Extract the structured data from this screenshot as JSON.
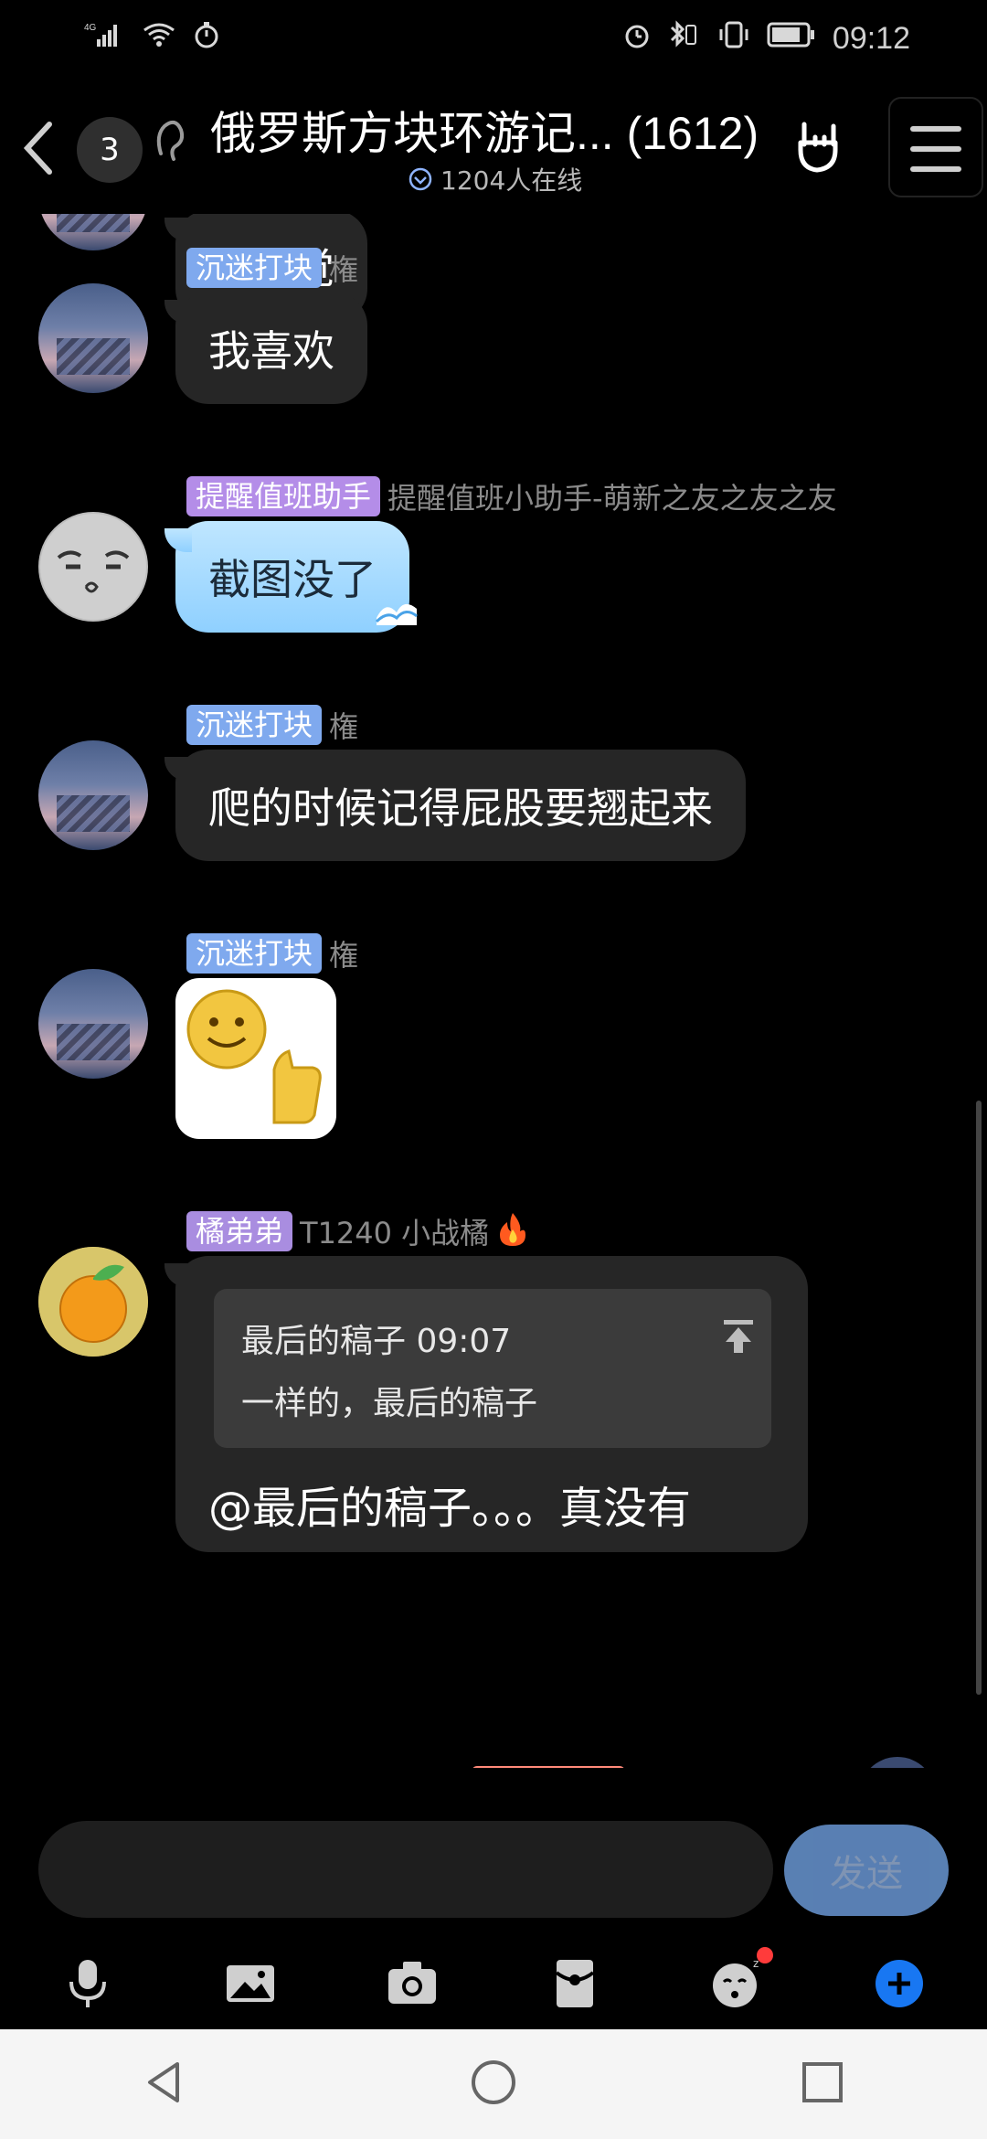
{
  "status_bar": {
    "network": "4G",
    "time": "09:12"
  },
  "header": {
    "unread_count": "3",
    "group_title": "俄罗斯方块环游记... (1612)",
    "online_text": "1204人在线"
  },
  "messages": [
    {
      "type": "text",
      "text": "很自觉"
    },
    {
      "type": "text",
      "tag": "沉迷打块",
      "sender": "権",
      "text": "我喜欢"
    },
    {
      "type": "text_special",
      "tag": "提醒值班助手",
      "sender": "提醒值班小助手-萌新之友之友之友",
      "text": "截图没了"
    },
    {
      "type": "text",
      "tag": "沉迷打块",
      "sender": "権",
      "text": "爬的时候记得屁股要翘起来"
    },
    {
      "type": "sticker",
      "tag": "沉迷打块",
      "sender": "権"
    },
    {
      "type": "quote_reply",
      "tag": "橘弟弟",
      "sender": "T1240 小战橘",
      "quote_head": "最后的稿子 09:07",
      "quote_text": "一样的，最后的稿子",
      "reply_text": "@最后的稿子。。。真没有"
    }
  ],
  "composer": {
    "input_value": "",
    "input_placeholder": "",
    "send_label": "发送"
  },
  "toolbar_icons": [
    "microphone-icon",
    "image-icon",
    "camera-icon",
    "red-packet-icon",
    "emoji-icon",
    "plus-icon"
  ],
  "colors": {
    "tag_blue": "#7fa9ee",
    "tag_purple": "#b48de8",
    "bubble_dark": "#262626",
    "send_blue": "#7fb6ff",
    "plus_blue": "#1877f2"
  }
}
